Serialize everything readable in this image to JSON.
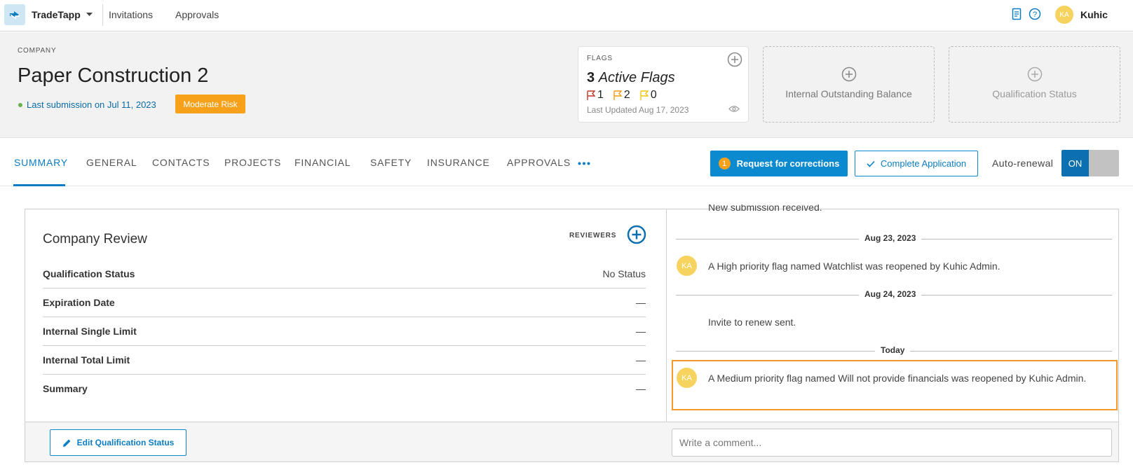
{
  "topnav": {
    "brand": "TradeTapp",
    "links": [
      "Invitations",
      "Approvals"
    ],
    "user": {
      "initials": "KA",
      "name": "Kuhic"
    }
  },
  "header": {
    "company_label": "COMPANY",
    "company_name": "Paper Construction 2",
    "last_submission": "Last submission on Jul 11, 2023",
    "risk": "Moderate Risk",
    "flags": {
      "title": "FLAGS",
      "count": "3",
      "count_label": "Active Flags",
      "high": "1",
      "medium": "2",
      "low": "0",
      "updated": "Last Updated Aug 17, 2023"
    },
    "cards": [
      "Internal Outstanding Balance",
      "Qualification Status"
    ]
  },
  "tabs": {
    "items": [
      "SUMMARY",
      "GENERAL",
      "CONTACTS",
      "PROJECTS",
      "FINANCIAL",
      "SAFETY",
      "INSURANCE",
      "APPROVALS"
    ],
    "request_badge": "1",
    "request_label": "Request for corrections",
    "complete_label": "Complete Application",
    "auto_renewal_label": "Auto-renewal",
    "toggle_on": "ON"
  },
  "review": {
    "title": "Company Review",
    "reviewers_label": "REVIEWERS",
    "rows": [
      {
        "label": "Qualification Status",
        "value": "No Status"
      },
      {
        "label": "Expiration Date",
        "value": "—"
      },
      {
        "label": "Internal Single Limit",
        "value": "—"
      },
      {
        "label": "Internal Total Limit",
        "value": "—"
      },
      {
        "label": "Summary",
        "value": "—"
      }
    ],
    "edit_button": "Edit Qualification Status"
  },
  "feed": {
    "partial": "New submission received.",
    "dates": [
      "Aug 23, 2023",
      "Aug 24, 2023",
      "Today"
    ],
    "items": [
      {
        "initials": "KA",
        "text": "A High priority flag named Watchlist was reopened by Kuhic Admin."
      },
      {
        "text": "Invite to renew sent."
      },
      {
        "initials": "KA",
        "text": "A Medium priority flag named Will not provide financials was reopened by Kuhic Admin."
      }
    ],
    "comment_placeholder": "Write a comment..."
  },
  "colors": {
    "primary": "#0b8ad0",
    "risk": "#f7a11a",
    "highlight": "#f59a2a",
    "avatar": "#f6d35e",
    "flag_high": "#c0392b",
    "flag_medium": "#f39c12",
    "flag_low": "#f1c40f"
  }
}
